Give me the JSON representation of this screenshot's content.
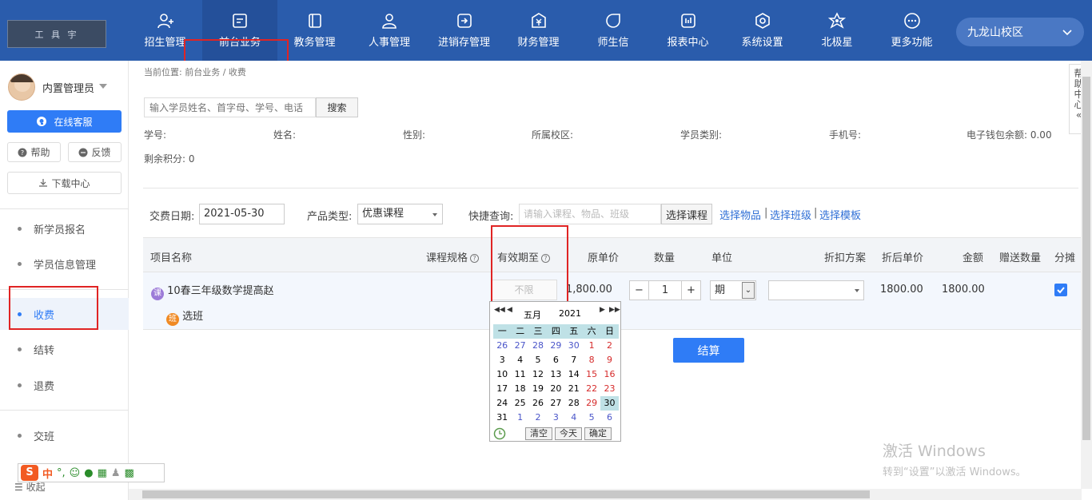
{
  "logo_text": "工 具 宇",
  "nav": [
    {
      "label": "招生管理",
      "icon": "user-add-icon"
    },
    {
      "label": "前台业务",
      "icon": "reception-icon",
      "active": true
    },
    {
      "label": "教务管理",
      "icon": "book-icon"
    },
    {
      "label": "人事管理",
      "icon": "person-icon"
    },
    {
      "label": "进销存管理",
      "icon": "inventory-icon"
    },
    {
      "label": "财务管理",
      "icon": "yuan-icon"
    },
    {
      "label": "师生信",
      "icon": "chat-icon"
    },
    {
      "label": "报表中心",
      "icon": "chart-icon"
    },
    {
      "label": "系统设置",
      "icon": "settings-icon"
    },
    {
      "label": "北极星",
      "icon": "star-icon"
    },
    {
      "label": "更多功能",
      "icon": "more-icon"
    }
  ],
  "campus": "九龙山校区",
  "sidebar": {
    "user_name": "内置管理员",
    "online_service": "在线客服",
    "help": "帮助",
    "feedback": "反馈",
    "download_center": "下载中心",
    "menu": [
      "新学员报名",
      "学员信息管理",
      "收费",
      "结转",
      "退费",
      "交班"
    ],
    "active_index": 2,
    "collapse": "收起"
  },
  "breadcrumb": "当前位置: 前台业务 / 收费",
  "search": {
    "placeholder": "输入学员姓名、首字母、学号、电话",
    "button": "搜索"
  },
  "student_info": {
    "id_label": "学号:",
    "name_label": "姓名:",
    "gender_label": "性别:",
    "campus_label": "所属校区:",
    "type_label": "学员类别:",
    "phone_label": "手机号:",
    "wallet_label": "电子钱包余额: 0.00",
    "points_label": "剩余积分: 0"
  },
  "form": {
    "date_label": "交费日期:",
    "date_value": "2021-05-30",
    "product_type_label": "产品类型:",
    "product_type_value": "优惠课程",
    "quick_label": "快捷查询:",
    "quick_placeholder": "请输入课程、物品、班级",
    "select_course": "选择课程",
    "select_item": "选择物品",
    "select_class": "选择班级",
    "select_template": "选择模板",
    "divider": "|"
  },
  "table": {
    "headers": [
      "项目名称",
      "课程规格",
      "有效期至",
      "原单价",
      "数量",
      "单位",
      "折扣方案",
      "折后单价",
      "金额",
      "赠送数量",
      "分摊"
    ],
    "row": {
      "course_badge": "课",
      "name": "10春三年级数学提高赵",
      "valid_until": "不限",
      "unit_price": "1,800.00",
      "quantity": "1",
      "minus": "−",
      "plus": "+",
      "unit": "期",
      "discounted_price": "1800.00",
      "amount": "1800.00",
      "class_badge": "班",
      "select_class": "选班",
      "allocate_checked": true
    }
  },
  "submit": "结算",
  "calendar": {
    "month": "五月",
    "year": "2021",
    "weekdays": [
      "一",
      "二",
      "三",
      "四",
      "五",
      "六",
      "日"
    ],
    "weeks": [
      [
        "26",
        "27",
        "28",
        "29",
        "30",
        "1",
        "2"
      ],
      [
        "3",
        "4",
        "5",
        "6",
        "7",
        "8",
        "9"
      ],
      [
        "10",
        "11",
        "12",
        "13",
        "14",
        "15",
        "16"
      ],
      [
        "17",
        "18",
        "19",
        "20",
        "21",
        "22",
        "23"
      ],
      [
        "24",
        "25",
        "26",
        "27",
        "28",
        "29",
        "30"
      ],
      [
        "31",
        "1",
        "2",
        "3",
        "4",
        "5",
        "6"
      ]
    ],
    "selected": "30",
    "clear": "清空",
    "today": "今天",
    "confirm": "确定"
  },
  "help_tab": [
    "帮",
    "助",
    "中",
    "心",
    "«"
  ],
  "windows_activation": {
    "title": "激活 Windows",
    "subtitle": "转到“设置”以激活 Windows。"
  },
  "ime": {
    "mode": "中"
  },
  "colors": {
    "nav_bg": "#2a5cac",
    "accent": "#2f7cf6",
    "highlight_box": "#e02424",
    "weekend": "#d62b2b",
    "other_month": "#4a55c9"
  }
}
